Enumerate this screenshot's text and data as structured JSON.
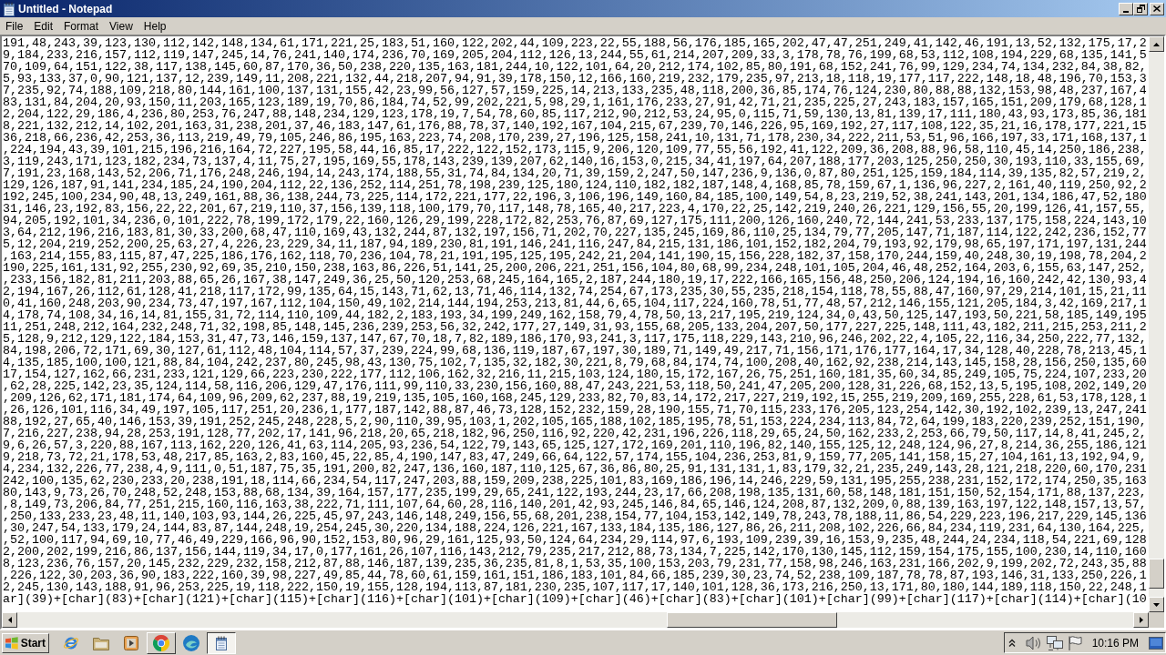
{
  "window": {
    "title": "Untitled - Notepad"
  },
  "menu": [
    "File",
    "Edit",
    "Format",
    "View",
    "Help"
  ],
  "editor": {
    "lines": [
      "191,48,243,39,123,130,112,142,148,134,61,171,221,25,183,51,160,122,202,44,109,223,22,55,188,56,176,185,165,202,47,47,251,249,41,142,46,191,13,52,132,175,17,2",
      "9,184,233,216,157,112,119,147,245,14,76,241,140,174,236,70,169,205,204,112,126,13,244,55,61,214,207,209,33,3,178,78,76,199,68,53,112,108,194,229,68,135,141,5",
      "70,109,64,151,122,38,117,138,145,60,87,170,36,50,238,220,135,163,181,244,10,122,101,64,20,212,174,102,85,80,191,68,152,241,76,99,129,234,74,134,232,84,38,82,",
      "5,93,133,37,0,90,121,137,12,239,149,11,208,221,132,44,218,207,94,91,39,178,150,12,166,160,219,232,179,235,97,213,18,118,19,177,117,222,148,18,48,196,70,153,3",
      "7,235,92,74,188,109,218,80,144,161,100,137,131,155,42,23,99,56,127,57,159,225,14,213,133,235,48,118,200,36,85,174,76,124,230,80,88,88,132,153,98,48,237,167,4",
      "83,131,84,204,20,93,150,11,203,165,123,189,19,70,86,184,74,52,99,202,221,5,98,29,1,161,176,233,27,91,42,71,21,235,225,27,243,183,157,165,151,209,179,68,128,1",
      "2,204,122,29,186,4,236,80,253,76,247,88,148,234,129,123,178,19,7,54,78,60,85,117,212,90,212,53,24,95,0,115,71,59,130,13,81,139,17,111,180,43,93,173,85,36,181",
      "8,221,132,212,14,102,201,163,31,238,201,37,46,183,147,61,176,88,78,37,140,192,167,104,215,67,239,70,146,226,95,169,192,27,117,108,122,35,21,16,178,177,221,15",
      "36,218,66,236,42,253,36,113,219,49,79,105,246,86,195,163,223,74,208,170,239,27,196,125,158,241,10,131,71,178,230,34,222,211,53,51,96,166,197,33,171,168,137,1",
      ",224,194,43,39,101,215,196,216,164,72,227,195,58,44,16,85,17,222,122,152,173,115,9,206,120,109,77,55,56,192,41,122,209,36,208,88,96,58,110,45,14,250,186,238,",
      "3,119,243,171,123,182,234,73,137,4,11,75,27,195,169,55,178,143,239,139,207,62,140,16,153,0,215,34,41,197,64,207,188,177,203,125,250,250,30,193,110,33,155,69,",
      "7,191,23,168,143,52,206,71,176,248,246,194,14,243,174,188,55,31,74,84,134,20,71,39,159,2,247,50,147,236,9,136,0,87,80,251,125,159,184,114,39,135,82,57,219,2,",
      "129,126,187,91,141,234,185,24,190,204,112,22,136,252,114,251,78,198,239,125,180,124,110,182,182,187,148,4,168,85,78,159,67,1,136,96,227,2,161,40,119,250,92,2",
      "192,245,100,234,90,48,13,249,161,88,36,138,244,73,225,114,172,221,177,22,196,3,106,196,149,160,84,185,100,149,54,8,23,219,52,38,241,143,201,134,186,47,52,180",
      "31,146,23,192,83,156,22,22,201,67,219,110,37,156,139,118,100,179,70,117,148,78,165,40,217,223,4,170,22,25,142,219,240,26,221,129,156,55,20,199,126,41,157,55,",
      "94,205,192,101,34,236,0,101,222,78,199,172,179,22,160,126,29,199,228,172,82,253,76,87,69,127,175,111,200,126,160,240,72,144,241,53,233,137,175,158,224,143,10",
      "3,64,212,196,216,183,81,30,33,200,68,47,110,169,43,132,244,87,132,197,156,71,202,70,227,135,245,169,86,110,25,134,79,77,205,147,71,187,114,122,242,236,152,77",
      "5,12,204,219,252,200,25,63,27,4,226,23,229,34,11,187,94,189,230,81,191,146,241,116,247,84,215,131,186,101,152,182,204,79,193,92,179,98,65,197,171,197,131,244",
      ",163,214,155,83,115,87,47,225,186,176,162,118,70,236,104,78,21,191,195,125,195,242,21,204,141,190,15,156,228,182,37,158,170,244,159,40,248,30,19,198,78,204,2",
      "190,225,161,131,92,255,230,92,69,35,210,150,238,163,86,226,51,141,25,200,206,221,251,156,104,80,68,99,234,248,101,105,204,46,48,252,164,203,6,155,63,147,252,",
      ",233,156,182,81,211,203,88,65,26,167,38,147,249,36,25,50,120,253,68,245,164,165,2,187,244,180,19,17,222,166,165,156,48,250,206,124,194,16,160,242,42,130,93,4",
      "2,194,167,26,112,61,128,41,218,117,172,99,135,64,15,143,71,62,13,71,46,114,132,74,254,67,173,235,30,55,235,218,154,118,78,55,88,47,160,97,29,214,101,15,21,11",
      "0,41,160,248,203,90,234,73,47,197,167,112,104,150,49,102,214,144,194,253,213,81,44,6,65,104,117,224,160,78,51,77,48,57,212,146,155,121,205,184,3,42,169,217,1",
      "4,178,74,108,34,16,14,81,155,31,72,114,110,109,44,182,2,183,193,34,199,249,162,158,79,4,78,50,13,217,195,219,124,34,0,43,50,125,147,193,50,221,58,185,149,195",
      "11,251,248,212,164,232,248,71,32,198,85,148,145,236,239,253,56,32,242,177,27,149,31,93,155,68,205,133,204,207,50,177,227,225,148,111,43,182,211,215,253,211,2",
      "5,128,9,212,129,122,184,153,31,47,73,146,159,137,147,67,70,18,7,82,189,186,170,93,241,3,117,175,118,229,143,210,96,246,202,22,4,105,22,116,34,250,222,77,132,",
      "84,198,206,72,171,69,30,127,61,112,48,104,114,57,37,239,224,99,68,136,119,187,67,197,30,189,71,149,49,217,71,156,171,176,177,164,17,34,128,40,228,78,213,45,1",
      "4,135,185,100,100,121,88,84,104,242,237,80,245,98,43,130,75,102,7,135,32,182,30,221,8,79,68,84,174,74,100,208,40,162,92,238,214,143,145,158,28,156,250,135,60",
      "17,154,127,162,66,231,233,121,129,66,223,230,222,177,112,106,162,32,216,11,215,103,124,180,15,172,167,26,75,251,160,181,35,60,34,85,249,105,75,224,107,233,20",
      ",62,28,225,142,23,35,124,114,58,116,206,129,47,176,111,99,110,33,230,156,160,88,47,243,221,53,118,50,241,47,205,200,128,31,226,68,152,13,5,195,108,202,149,20",
      ",209,126,62,171,181,174,64,109,96,209,62,237,88,19,219,135,105,160,168,245,129,233,82,70,83,14,172,217,227,219,192,15,255,219,209,169,255,228,61,53,178,128,1",
      ",26,126,101,116,34,49,197,105,117,251,20,236,1,177,187,142,88,87,46,73,128,152,232,159,28,190,155,71,70,115,233,176,205,123,254,142,30,192,102,239,13,247,241",
      "88,192,27,65,40,146,153,39,191,252,245,248,228,5,2,90,110,39,95,103,1,202,105,165,188,102,185,195,78,51,153,224,234,113,84,72,64,199,183,220,239,252,151,190,",
      "7,216,227,238,94,28,253,191,128,77,202,17,141,96,218,20,65,218,182,96,250,116,92,220,42,231,196,226,118,29,65,24,50,162,233,2,253,66,79,50,117,14,8,41,245,2,",
      "9,6,26,57,3,220,88,167,113,162,220,126,41,63,114,205,93,236,54,122,79,143,65,125,127,172,169,201,110,196,82,140,155,125,12,248,124,96,27,8,214,36,255,186,121",
      "9,218,73,72,21,178,53,48,217,85,163,2,83,160,45,22,85,4,190,147,83,47,249,66,64,122,57,174,155,104,236,253,81,9,159,77,205,141,158,15,27,104,161,13,192,94,9,",
      "4,234,132,226,77,238,4,9,111,0,51,187,75,35,191,200,82,247,136,160,187,110,125,67,36,86,80,25,91,131,131,1,83,179,32,21,235,249,143,28,121,218,220,60,170,231",
      "242,100,135,62,230,233,20,238,191,18,114,66,234,54,117,247,203,88,159,209,238,225,101,83,169,186,196,14,246,229,59,131,195,255,238,231,152,172,174,250,35,163",
      "80,143,9,73,26,70,248,52,248,153,88,68,134,39,164,157,177,235,199,29,65,241,122,193,244,23,17,66,208,198,135,131,60,58,148,181,151,150,52,154,171,88,137,223,",
      ",8,149,73,206,84,77,251,215,160,116,163,38,222,71,111,107,64,60,28,116,140,201,42,93,245,146,84,65,146,124,208,87,132,209,0,88,139,163,197,122,148,157,13,57,",
      ",250,133,233,23,48,11,140,103,93,144,26,225,45,97,243,146,148,249,156,55,68,201,238,154,77,104,153,142,149,78,243,78,188,11,86,54,229,223,196,217,229,145,136",
      ",30,247,54,133,179,24,144,83,87,144,248,19,254,245,30,220,134,188,224,126,221,167,133,184,135,186,127,86,26,211,208,102,226,66,84,234,119,231,64,130,164,225,",
      ",52,100,117,94,69,10,77,46,49,229,166,96,90,152,153,80,96,29,161,125,93,50,124,64,234,29,114,97,6,193,109,239,39,16,153,9,235,48,244,24,234,118,54,221,69,128",
      "2,200,202,199,216,86,137,156,144,119,34,17,0,177,161,26,107,116,143,212,79,235,217,212,88,73,134,7,225,142,170,130,145,112,159,154,175,155,100,230,14,110,160",
      "8,123,236,76,157,20,145,232,229,232,158,212,87,88,146,187,139,235,36,235,81,8,1,53,35,100,153,203,79,231,77,158,98,246,163,231,166,202,9,199,202,72,243,35,88",
      ",226,122,30,203,36,90,183,222,160,39,98,227,49,85,44,78,60,61,159,161,151,186,183,101,84,66,185,239,30,23,74,52,238,109,187,78,78,87,193,146,31,133,250,226,1",
      "2,245,130,143,188,91,96,253,225,19,118,222,150,19,155,128,194,113,87,181,230,235,107,117,17,140,101,128,36,173,216,250,13,171,80,180,144,189,118,150,22,248,1",
      "ar](39)+[char](83)+[char](121)+[char](115)+[char](116)+[char](101)+[char](109)+[char](46)+[char](83)+[char](101)+[char](99)+[char](117)+[char](114)+[char](10"
    ]
  },
  "taskbar": {
    "start": "Start",
    "buttons": [
      {
        "kind": "pinned",
        "selected": false
      },
      {
        "kind": "pinned",
        "selected": false
      },
      {
        "kind": "pinned",
        "selected": false
      },
      {
        "kind": "window",
        "selected": false
      },
      {
        "kind": "pinned",
        "selected": false
      },
      {
        "kind": "window",
        "selected": true
      }
    ],
    "clock": "10:16 PM"
  }
}
